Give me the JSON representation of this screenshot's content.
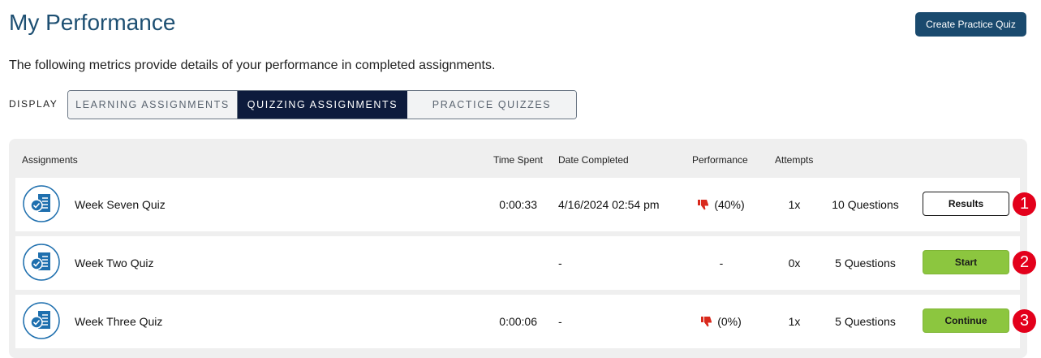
{
  "header": {
    "title": "My Performance",
    "create_button_label": "Create Practice Quiz"
  },
  "subtitle": "The following metrics provide details of your performance in completed assignments.",
  "display": {
    "label": "DISPLAY",
    "options": [
      {
        "label": "LEARNING ASSIGNMENTS",
        "selected": false
      },
      {
        "label": "QUIZZING ASSIGNMENTS",
        "selected": true
      },
      {
        "label": "PRACTICE QUIZZES",
        "selected": false
      }
    ]
  },
  "table": {
    "headers": {
      "assignments": "Assignments",
      "time_spent": "Time Spent",
      "date_completed": "Date Completed",
      "performance": "Performance",
      "attempts": "Attempts"
    },
    "rows": [
      {
        "icon": "quiz-document-icon",
        "name": "Week Seven Quiz",
        "time_spent": "0:00:33",
        "date_completed": "4/16/2024 02:54 pm",
        "performance": "(40%)",
        "performance_icon": "thumbs-down-icon",
        "attempts": "1x",
        "questions": "10 Questions",
        "action": "Results",
        "badge": "1"
      },
      {
        "icon": "quiz-document-icon",
        "name": "Week Two Quiz",
        "time_spent": "",
        "date_completed": "-",
        "performance": "-",
        "attempts": "0x",
        "questions": "5 Questions",
        "action": "Start",
        "badge": "2"
      },
      {
        "icon": "quiz-document-icon",
        "name": "Week Three Quiz",
        "time_spent": "0:00:06",
        "date_completed": "-",
        "performance": "(0%)",
        "performance_icon": "thumbs-down-icon",
        "attempts": "1x",
        "questions": "5 Questions",
        "action": "Continue",
        "badge": "3"
      }
    ]
  },
  "colors": {
    "title": "#1d4f72",
    "primary_button": "#1a4a6e",
    "selected_segment": "#0d1b3c",
    "green_button": "#8cc63f",
    "badge": "#e3001b",
    "thumbs_down": "#d9291c"
  }
}
